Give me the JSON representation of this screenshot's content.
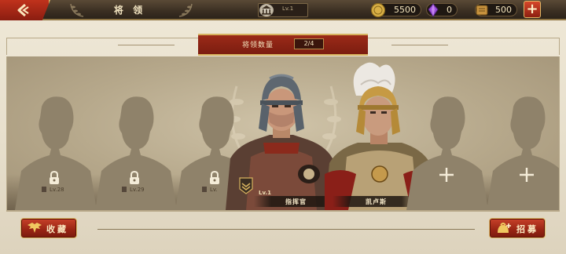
{
  "topbar": {
    "title": "将 领",
    "level": "Lv.1",
    "resources": [
      {
        "name": "gold",
        "icon": "gold-coin-icon",
        "value": "5500"
      },
      {
        "name": "gem",
        "icon": "purple-gem-icon",
        "value": "0"
      },
      {
        "name": "tokens",
        "icon": "scroll-token-icon",
        "value": "500"
      }
    ],
    "add_label": "+"
  },
  "header": {
    "count_label": "将领数量",
    "count_value": "2/4"
  },
  "roster": {
    "locked_slots": [
      {
        "level": "Lv.28"
      },
      {
        "level": "Lv.29"
      },
      {
        "level": "Lv."
      }
    ],
    "heroes": [
      {
        "name": "指挥官",
        "level": "Lv.1"
      },
      {
        "name": "凯卢斯"
      }
    ],
    "empty_slots": 2
  },
  "actions": {
    "collect_label": "收藏",
    "recruit_label": "招募"
  },
  "colors": {
    "accent_red": "#9b2615",
    "gold_trim": "#d6b25e",
    "panel_bg": "#b6a88b"
  }
}
